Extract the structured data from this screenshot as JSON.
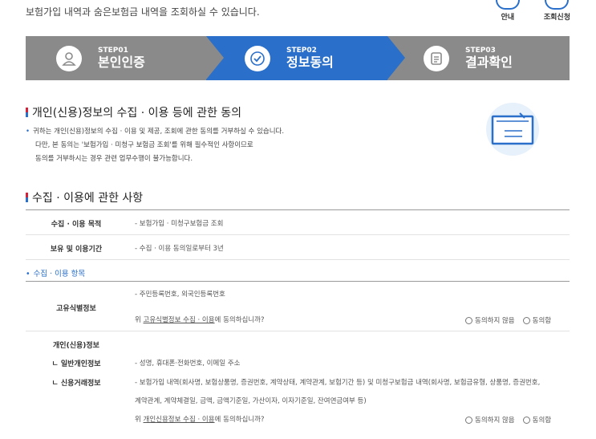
{
  "intro_text": "보험가입 내역과 숨은보험금 내역을 조회하실 수 있습니다.",
  "top_links": [
    {
      "label": "안내"
    },
    {
      "label": "조회신청"
    }
  ],
  "steps": [
    {
      "label": "STEP01",
      "title": "본인인증"
    },
    {
      "label": "STEP02",
      "title": "정보동의"
    },
    {
      "label": "STEP03",
      "title": "결과확인"
    }
  ],
  "consent_section": {
    "title": "개인(신용)정보의 수집 · 이용 등에 관한 동의",
    "lines": [
      "귀하는 개인(신용)정보의 수집 · 이용 및 제공, 조회에 관한 동의를 거부하실 수 있습니다.",
      "다만, 본 동의는 '보험가입 · 미청구 보험금 조회'를 위해 필수적인 사항이므로",
      "동의를 거부하시는 경우 관련 업무수행이 불가능합니다."
    ]
  },
  "usage_section": {
    "title": "수집 · 이용에 관한 사항",
    "rows": [
      {
        "key": "수집 · 이용 목적",
        "value": "- 보험가입 · 미청구보험금 조회"
      },
      {
        "key": "보유 및 이용기간",
        "value": "- 수집 · 이용 동의일로부터 3년"
      }
    ],
    "items_label": "수집 · 이용 항목"
  },
  "unique_id": {
    "key": "고유식별정보",
    "value": "- 주민등록번호, 외국인등록번호",
    "question_prefix": "위 ",
    "question_link": "고유식별정보 수집 · 이용",
    "question_suffix": "에 동의하십니까?",
    "disagree": "동의하지 않음",
    "agree": "동의함"
  },
  "personal_info": {
    "key": "개인(신용)정보",
    "general_key": "ㄴ 일반개인정보",
    "general_value": "- 성명, 휴대폰·전화번호, 이메일 주소",
    "credit_key": "ㄴ 신용거래정보",
    "credit_value_1": "- 보험가입 내역(회사명, 보험상품명, 증권번호, 계약상태, 계약관계, 보험기간 등) 및 미청구보험금 내역(회사명, 보험금유형, 상품명, 증권번호,",
    "credit_value_2": "계약관계, 계약체결일, 금액, 금액기준일, 가산이자, 이자기준일, 잔여연금여부 등)",
    "question_prefix": "위 ",
    "question_link": "개인신용정보 수집 · 이용",
    "question_suffix": "에 동의하십니까?",
    "disagree": "동의하지 않음",
    "agree": "동의함"
  },
  "colors": {
    "accent": "#2a6fc9",
    "step_inactive": "#8a8a8a",
    "title_red": "#d2233b"
  }
}
